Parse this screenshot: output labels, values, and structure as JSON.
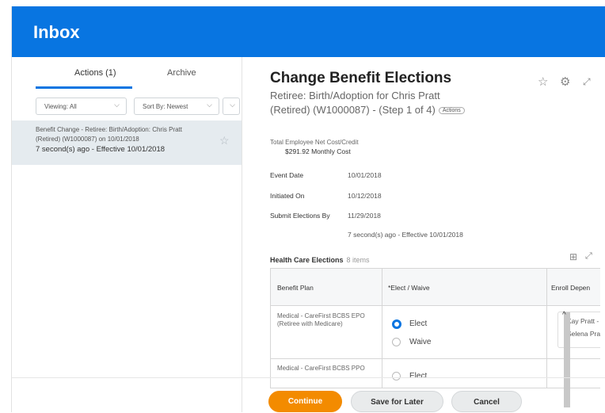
{
  "header": {
    "title": "Inbox"
  },
  "left": {
    "tabs": [
      {
        "label": "Actions (1)"
      },
      {
        "label": "Archive"
      }
    ],
    "filters": {
      "viewing": "Viewing: All",
      "sort": "Sort By: Newest"
    },
    "item": {
      "line1": "Benefit Change - Retiree: Birth/Adoption: Chris Pratt",
      "line2": "(Retired) (W1000087) on 10/01/2018",
      "line3": "7 second(s) ago - Effective 10/01/2018"
    }
  },
  "task": {
    "title": "Change Benefit Elections",
    "subtitle_line1": "Retiree: Birth/Adoption for Chris Pratt",
    "subtitle_line2": "(Retired) (W1000087) - (Step 1 of 4)",
    "actions_badge": "Actions",
    "cost_label": "Total Employee Net Cost/Credit",
    "cost_value": "$291.92 Monthly Cost",
    "fields": [
      {
        "label": "Event Date",
        "value": "10/01/2018"
      },
      {
        "label": "Initiated On",
        "value": "10/12/2018"
      },
      {
        "label": "Submit Elections By",
        "value": "11/29/2018"
      },
      {
        "label": "",
        "value": "7 second(s) ago - Effective 10/01/2018"
      }
    ]
  },
  "grid": {
    "title": "Health Care Elections",
    "count": "8 items",
    "columns": [
      "Benefit Plan",
      "*Elect / Waive",
      "Enroll Depen"
    ],
    "rows": [
      {
        "plan_line1": "Medical - CareFirst BCBS EPO",
        "plan_line2": "(Retiree with Medicare)",
        "option1": "Elect",
        "option2": "Waive",
        "selected": "Elect",
        "dep1": "Kay Pratt - A",
        "dep2": "Selena Pra"
      },
      {
        "plan_line1": "Medical - CareFirst BCBS PPO",
        "plan_line2": "",
        "option1": "Elect"
      }
    ]
  },
  "buttons": {
    "continue": "Continue",
    "save": "Save for Later",
    "cancel": "Cancel"
  },
  "colors": {
    "brand": "#0875e1",
    "primary_button": "#f38b00"
  }
}
